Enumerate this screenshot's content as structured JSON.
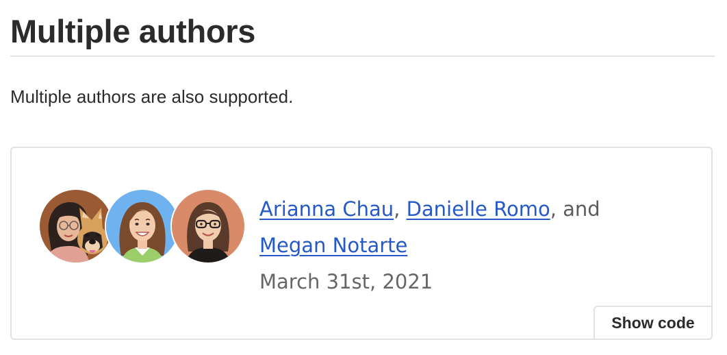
{
  "section": {
    "title": "Multiple authors",
    "intro": "Multiple authors are also supported."
  },
  "example": {
    "authors": [
      {
        "name": "Arianna Chau",
        "avatar": "avatar-woman-with-dog"
      },
      {
        "name": "Danielle Romo",
        "avatar": "avatar-woman-brown-hair"
      },
      {
        "name": "Megan Notarte",
        "avatar": "avatar-woman-glasses"
      }
    ],
    "separator_comma": ",",
    "separator_and": ", and",
    "date": "March 31st, 2021",
    "show_code_label": "Show code"
  },
  "colors": {
    "link": "#2459c7",
    "title_rule": "#e3e3e3",
    "card_border": "#e2e2e2",
    "avatar_1_bg": "#9a5a33",
    "avatar_2_bg": "#6fb2f0",
    "avatar_3_bg": "#d98a68"
  }
}
